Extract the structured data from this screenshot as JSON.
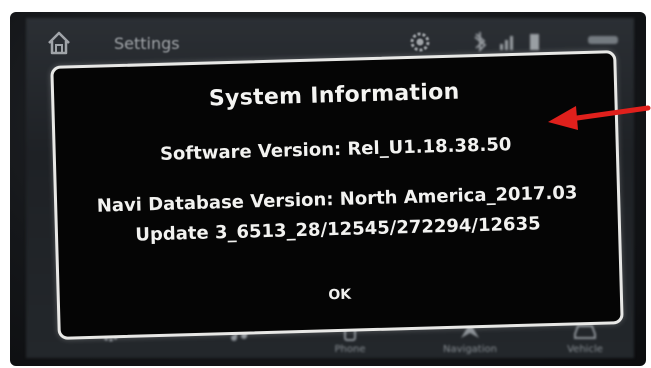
{
  "header": {
    "title": "Settings",
    "home_icon": "home-icon",
    "gear_icon": "gear-icon",
    "status_icons": [
      "bluetooth-icon",
      "signal-icon",
      "battery-icon"
    ]
  },
  "dialog": {
    "title": "System Information",
    "software_version": "Software Version: Rel_U1.18.38.50",
    "navi_database_version": "Navi Database Version: North America_2017.03",
    "update": "Update 3_6513_28/12545/272294/12635",
    "ok_label": "OK"
  },
  "bottom_nav": {
    "items": [
      {
        "label": "",
        "icon": "gear-icon"
      },
      {
        "label": "",
        "icon": "music-icon"
      },
      {
        "label": "Phone",
        "icon": "phone-icon"
      },
      {
        "label": "Navigation",
        "icon": "navigation-icon"
      },
      {
        "label": "Vehicle",
        "icon": "vehicle-icon"
      }
    ]
  },
  "annotation": {
    "arrow_color": "#e0201c"
  },
  "colors": {
    "dialog_bg": "#050505",
    "dialog_border": "#e8e8e6",
    "text": "#f2f2f0",
    "arrow": "#e0201c"
  }
}
